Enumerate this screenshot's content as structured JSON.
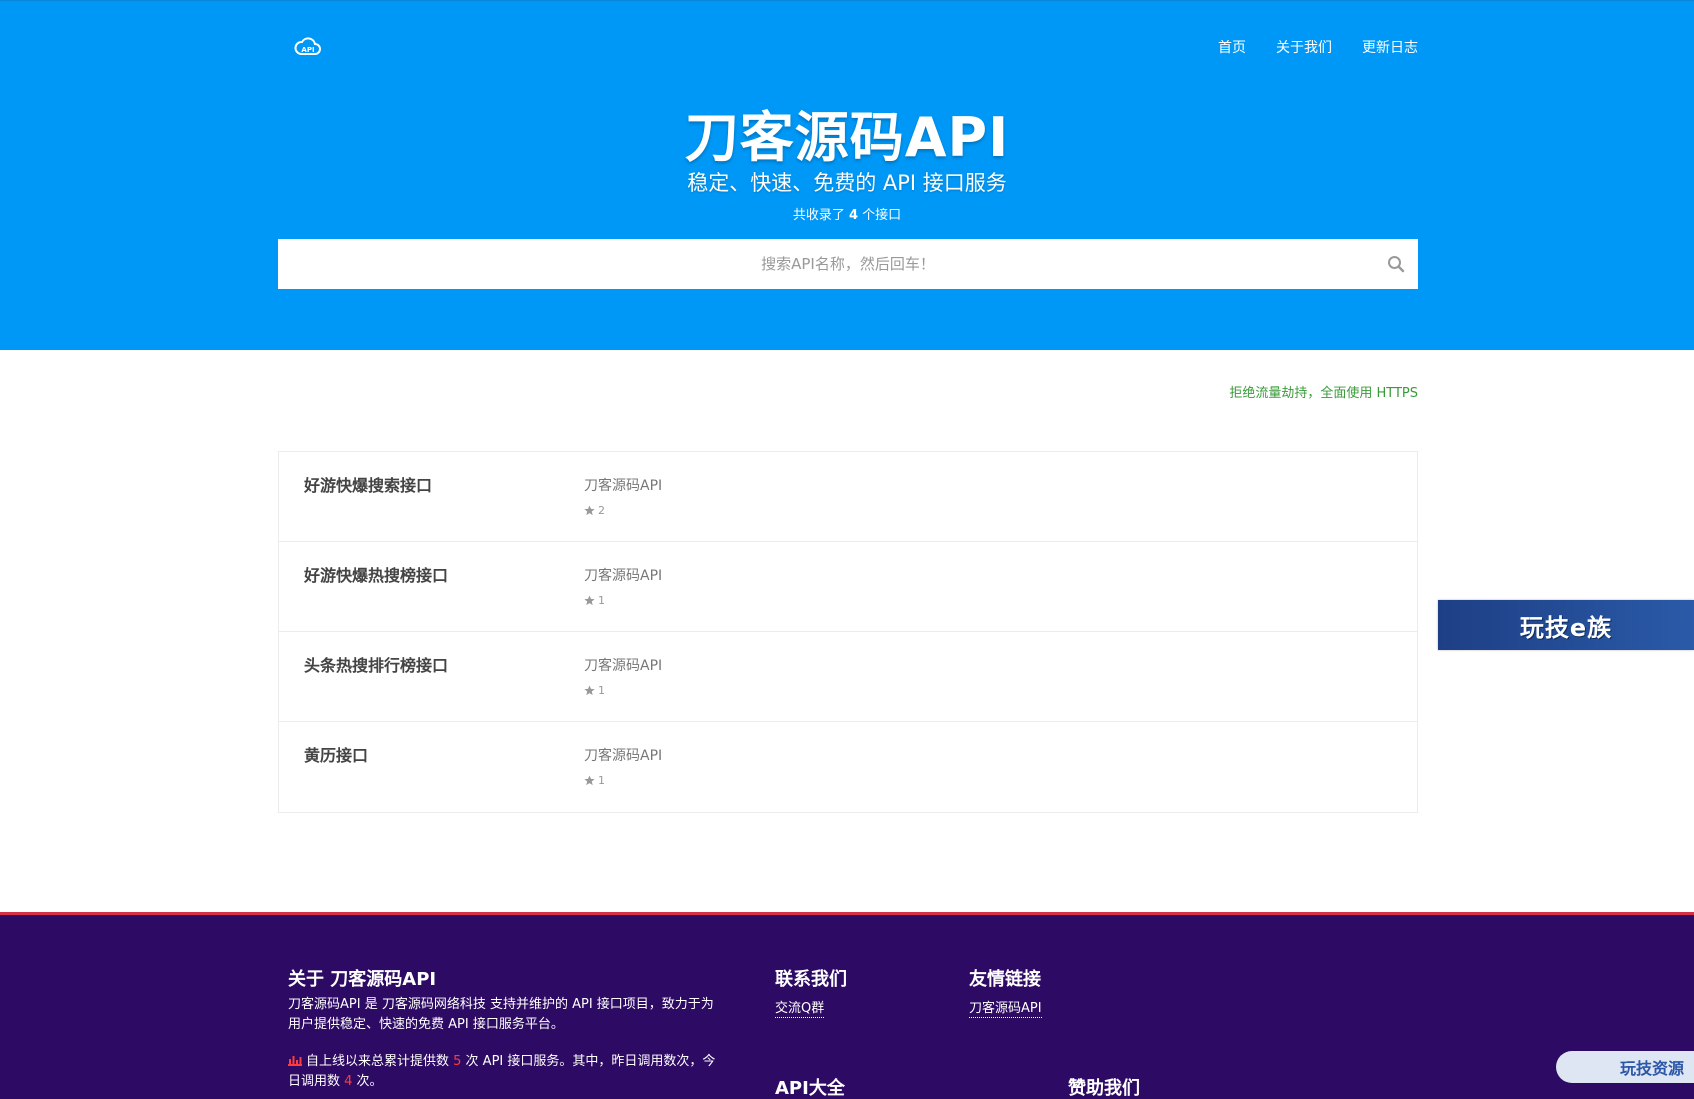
{
  "header": {
    "logo_text": "API",
    "nav": [
      "首页",
      "关于我们",
      "更新日志"
    ],
    "title": "刀客源码API",
    "subtitle": "稳定、快速、免费的 API 接口服务",
    "count_prefix": "共收录了 ",
    "count_value": "4",
    "count_suffix": " 个接口",
    "search_placeholder": "搜索API名称，然后回车！"
  },
  "notice": "拒绝流量劫持，全面使用 HTTPS",
  "apis": [
    {
      "name": "好游快爆搜索接口",
      "author": "刀客源码API",
      "stars": "2"
    },
    {
      "name": "好游快爆热搜榜接口",
      "author": "刀客源码API",
      "stars": "1"
    },
    {
      "name": "头条热搜排行榜接口",
      "author": "刀客源码API",
      "stars": "1"
    },
    {
      "name": "黄历接口",
      "author": "刀客源码API",
      "stars": "1"
    }
  ],
  "side_banner": "玩技e族",
  "footer": {
    "about_title": "关于 刀客源码API",
    "about_text": "刀客源码API 是 刀客源码网络科技 支持并维护的 API 接口项目，致力于为用户提供稳定、快速的免费 API 接口服务平台。",
    "stats_prefix": "自上线以来总累计提供数 ",
    "stats_total": "5",
    "stats_mid": " 次 API 接口服务。其中，昨日调用数次，今日调用数 ",
    "stats_today": "4",
    "stats_suffix": " 次。",
    "contact_title": "联系我们",
    "contact_link": "交流Q群",
    "links_title": "友情链接",
    "links_link": "刀客源码API",
    "api_all_title": "API大全",
    "sponsor_title": "赞助我们"
  },
  "corner_badge": "玩技资源",
  "colors": {
    "hero_bg": "#0098f7",
    "footer_bg": "#2d0a63",
    "footer_border": "#d4304a",
    "notice": "#3a9a3a"
  }
}
